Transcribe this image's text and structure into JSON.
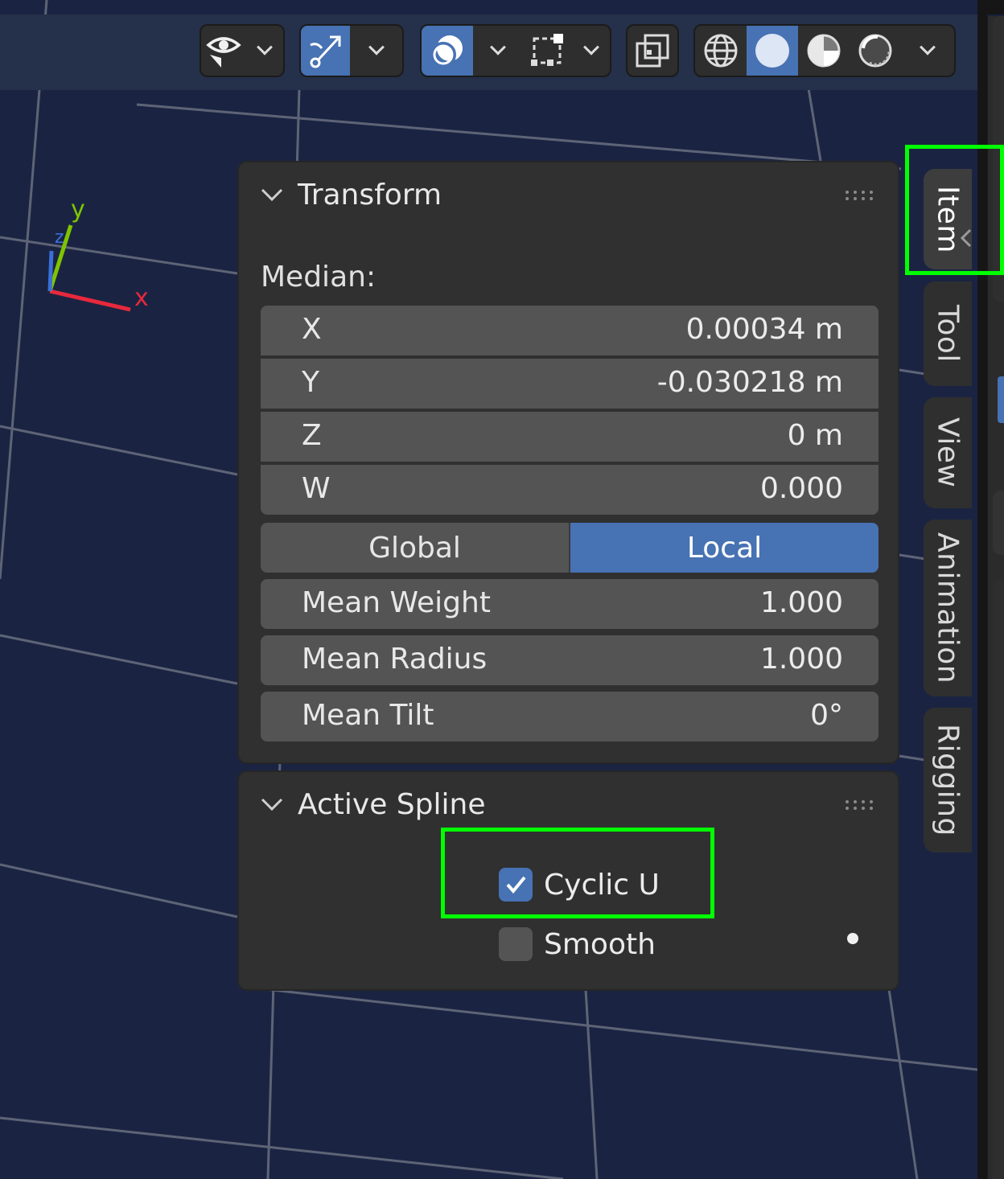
{
  "header": {
    "icons": [
      "visibility-eye-icon",
      "chevron-down-icon",
      "gizmo-arrow-icon",
      "chevron-down-icon",
      "overlay-icon",
      "chevron-down-icon",
      "selection-box-icon",
      "chevron-down-icon",
      "xray-toggle-icon",
      "wireframe-shading-icon",
      "solid-shading-icon",
      "material-shading-icon",
      "rendered-shading-icon",
      "chevron-down-icon"
    ]
  },
  "sidebar_tabs": [
    "Item",
    "Tool",
    "View",
    "Animation",
    "Rigging"
  ],
  "active_tab": "Item",
  "gizmo": {
    "x_label": "x",
    "y_label": "y",
    "z_label": "z"
  },
  "transform": {
    "title": "Transform",
    "median_label": "Median:",
    "fields": [
      {
        "label": "X",
        "value": "0.00034 m"
      },
      {
        "label": "Y",
        "value": "-0.030218 m"
      },
      {
        "label": "Z",
        "value": "0 m"
      },
      {
        "label": "W",
        "value": "0.000"
      }
    ],
    "space_options": [
      "Global",
      "Local"
    ],
    "space_selected": "Local",
    "mean_fields": [
      {
        "label": "Mean Weight",
        "value": "1.000"
      },
      {
        "label": "Mean Radius",
        "value": "1.000"
      },
      {
        "label": "Mean Tilt",
        "value": "0°"
      }
    ]
  },
  "active_spline": {
    "title": "Active Spline",
    "cyclic_u": {
      "label": "Cyclic U",
      "checked": true
    },
    "smooth": {
      "label": "Smooth",
      "checked": false
    }
  },
  "colors": {
    "accent": "#4772b3",
    "highlight": "#00ff00",
    "viewport": "#1a2442",
    "panel": "#303030",
    "field": "#545454"
  }
}
